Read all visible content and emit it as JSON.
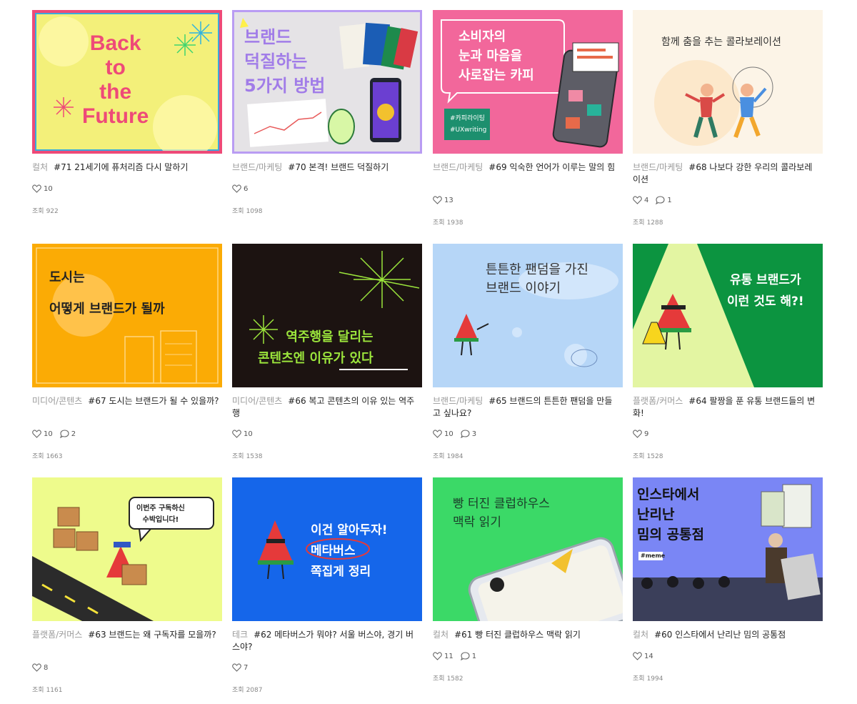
{
  "cards": [
    {
      "category": "컬처",
      "title": "#71 21세기에 퓨처리즘 다시 말하기",
      "likes": "10",
      "comments": "",
      "views_label": "조회",
      "views": "922",
      "thumb": {
        "bg": "#f3f07a",
        "text": "Back\nto\nthe\nFuture"
      }
    },
    {
      "category": "브랜드/마케팅",
      "title": "#70 본격! 브랜드 덕질하기",
      "likes": "6",
      "comments": "",
      "views_label": "조회",
      "views": "1098",
      "thumb": {
        "bg": "#e5e3e6",
        "text": "브랜드\n덕질하는\n5가지 방법"
      }
    },
    {
      "category": "브랜드/마케팅",
      "title": "#69 익숙한 언어가 이루는 말의 힘",
      "likes": "13",
      "comments": "",
      "views_label": "조회",
      "views": "1938",
      "thumb": {
        "bg": "#f2679b",
        "text": "소비자의\n눈과 마음을\n사로잡는 카피",
        "tags": "#카피라이팅\n#UXwriting"
      }
    },
    {
      "category": "브랜드/마케팅",
      "title": "#68 나보다 강한 우리의 콜라보레이션",
      "likes": "4",
      "comments": "1",
      "views_label": "조회",
      "views": "1288",
      "thumb": {
        "bg": "#fcf4e7",
        "text": "함께 춤을 추는 콜라보레이션"
      }
    },
    {
      "category": "미디어/콘텐츠",
      "title": "#67 도시는 브랜드가 될 수 있을까?",
      "likes": "10",
      "comments": "2",
      "views_label": "조회",
      "views": "1663",
      "thumb": {
        "bg": "#fbab05",
        "text": "도시는\n어떻게 브랜드가 될까"
      }
    },
    {
      "category": "미디어/콘텐츠",
      "title": "#66 복고 콘텐츠의 이유 있는 역주행",
      "likes": "10",
      "comments": "",
      "views_label": "조회",
      "views": "1538",
      "thumb": {
        "bg": "#1c1311",
        "text": "역주행을 달리는\n콘텐츠엔 이유가 있다"
      }
    },
    {
      "category": "브랜드/마케팅",
      "title": "#65 브랜드의 튼튼한 팬덤을 만들고 싶나요?",
      "likes": "10",
      "comments": "3",
      "views_label": "조회",
      "views": "1984",
      "thumb": {
        "bg": "#b6d6f7",
        "text": "튼튼한 팬덤을 가진\n브랜드 이야기"
      }
    },
    {
      "category": "플랫폼/커머스",
      "title": "#64 팔짱을 푼 유통 브랜드들의 변화!",
      "likes": "9",
      "comments": "",
      "views_label": "조회",
      "views": "1528",
      "thumb": {
        "bg": "#0c9440",
        "text": "유통 브랜드가\n이런 것도 해?!"
      }
    },
    {
      "category": "플랫폼/커머스",
      "title": "#63 브랜드는 왜 구독자를 모을까?",
      "likes": "8",
      "comments": "",
      "views_label": "조회",
      "views": "1161",
      "thumb": {
        "bg": "#eefb8c",
        "text": "이번주 구독하신\n수박입니다!"
      }
    },
    {
      "category": "테크",
      "title": "#62 메타버스가 뭐야? 서울 버스야, 경기 버스야?",
      "likes": "7",
      "comments": "",
      "views_label": "조회",
      "views": "2087",
      "thumb": {
        "bg": "#1566ea",
        "text": "이건 알아두자!\n메타버스\n쪽집게 정리"
      }
    },
    {
      "category": "컬처",
      "title": "#61 빵 터진 클럽하우스 맥락 읽기",
      "likes": "11",
      "comments": "1",
      "views_label": "조회",
      "views": "1582",
      "thumb": {
        "bg": "#3bd967",
        "text": "빵 터진 클럽하우스\n맥락 읽기"
      }
    },
    {
      "category": "컬처",
      "title": "#60 인스타에서 난리난 밈의 공통점",
      "likes": "14",
      "comments": "",
      "views_label": "조회",
      "views": "1994",
      "thumb": {
        "bg": "#7a86f5",
        "text": "인스타에서\n난리난\n밈의 공통점",
        "tag": "#meme"
      }
    }
  ]
}
